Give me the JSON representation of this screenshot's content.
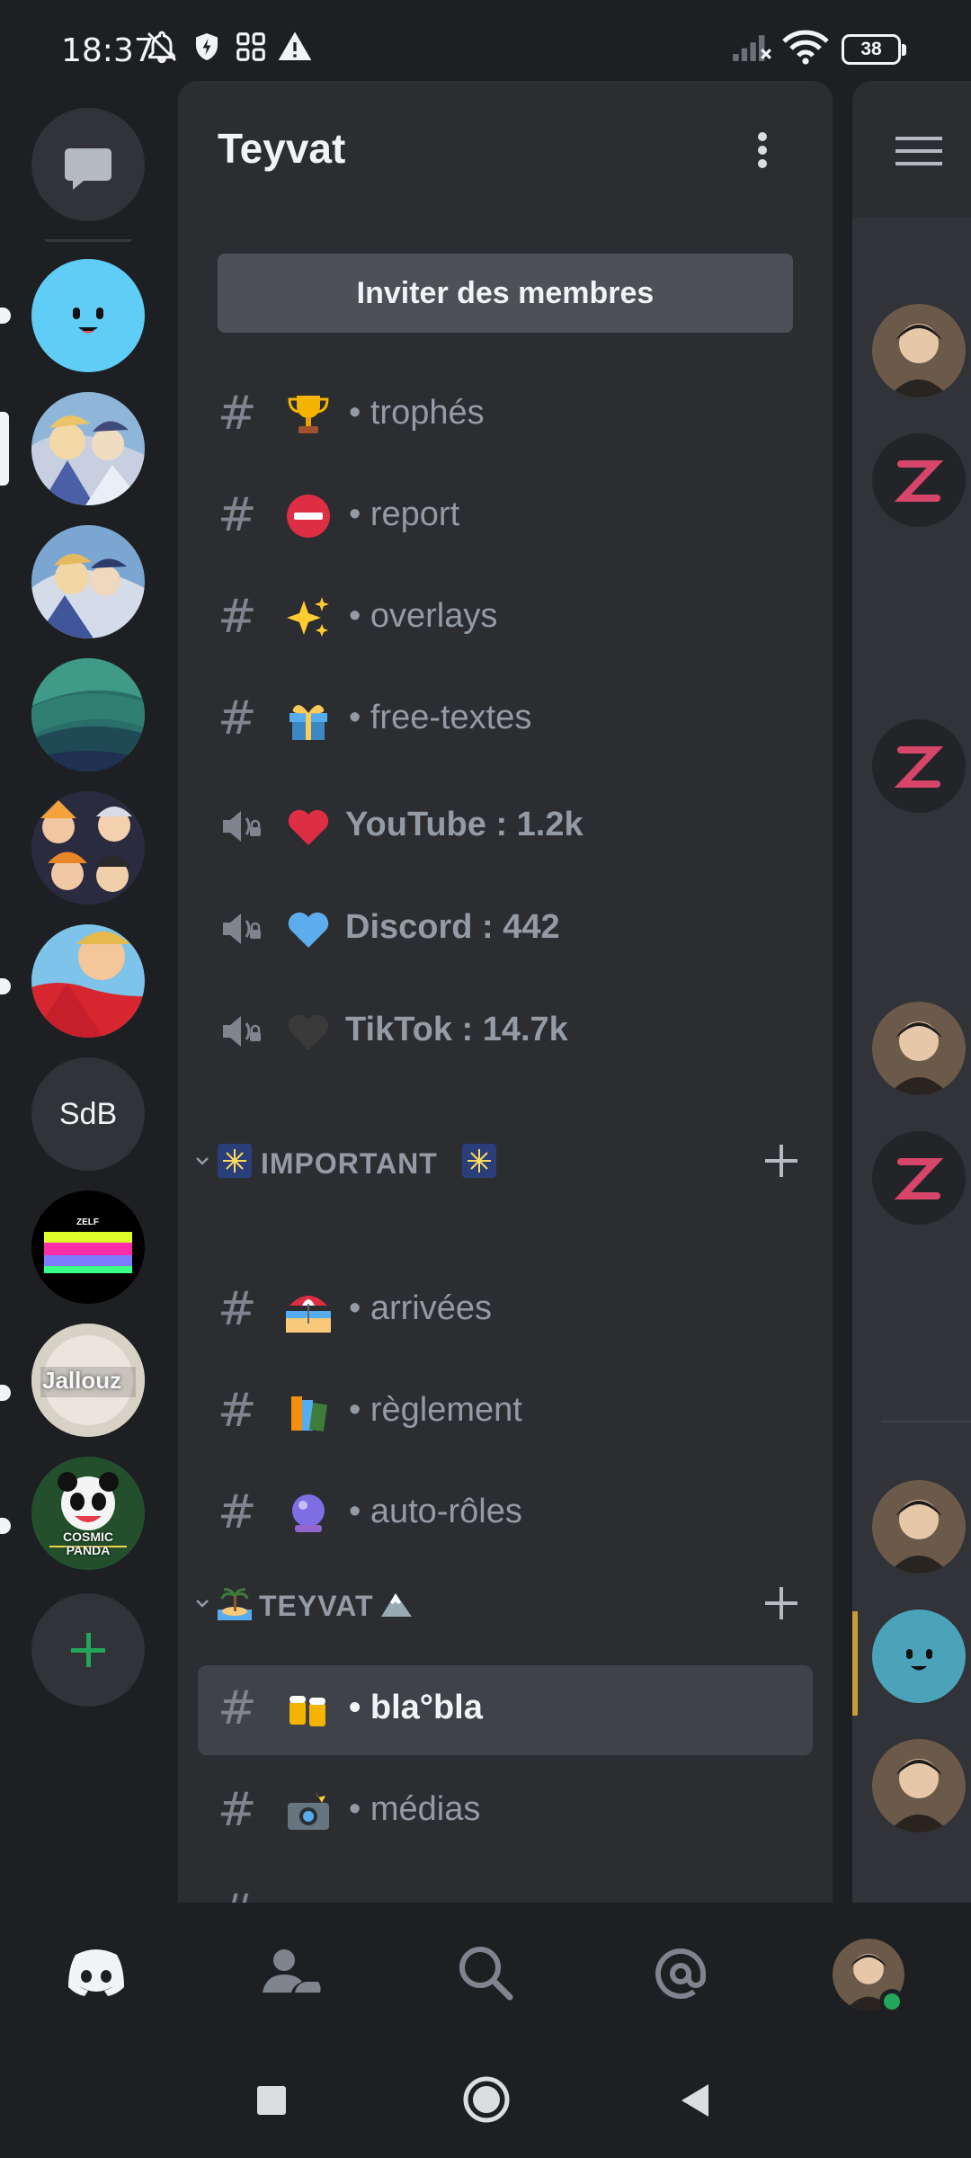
{
  "status_bar": {
    "time": "18:37",
    "battery": "38",
    "left_icons": [
      "bell-off-icon",
      "shield-icon",
      "apps-grid-icon",
      "warning-icon"
    ],
    "right_icons": [
      "signal-icon",
      "wifi-icon",
      "battery-icon"
    ]
  },
  "server": {
    "name": "Teyvat",
    "invite_label": "Inviter des membres"
  },
  "rail": {
    "sdb_label": "SdB",
    "zelf_label": "ZELF",
    "jallouz_label": "Jallouz",
    "cosmic_label": "COSMIC PANDA"
  },
  "channels_top": [
    {
      "type": "text",
      "emoji": "trophy",
      "name": "• trophés"
    },
    {
      "type": "text",
      "emoji": "no-entry",
      "name": "• report"
    },
    {
      "type": "text",
      "emoji": "sparkles",
      "name": "• overlays"
    },
    {
      "type": "text",
      "emoji": "gift",
      "name": "• free-textes"
    },
    {
      "type": "voice",
      "emoji": "red-heart",
      "name": "YouTube : 1.2k"
    },
    {
      "type": "voice",
      "emoji": "blue-heart",
      "name": "Discord : 442"
    },
    {
      "type": "voice",
      "emoji": "black-heart",
      "name": "TikTok : 14.7k"
    }
  ],
  "categories": [
    {
      "label": "IMPORTANT",
      "emoji_left": "fireworks",
      "emoji_right": "fireworks",
      "channels": [
        {
          "emoji": "beach-umbrella",
          "name": "• arrivées"
        },
        {
          "emoji": "books",
          "name": "• règlement"
        },
        {
          "emoji": "crystal-ball",
          "name": "• auto-rôles"
        }
      ]
    },
    {
      "label": "TEYVAT",
      "emoji_left": "desert-island",
      "emoji_right": "snow-mountain",
      "channels": [
        {
          "emoji": "beer-mugs",
          "name": "• bla°bla",
          "selected": true
        },
        {
          "emoji": "camera-flash",
          "name": "• médias"
        }
      ]
    }
  ],
  "colors": {
    "bg": "#1e1f22",
    "panel": "#2b2d31",
    "selected": "#404249",
    "button": "#4e5058",
    "muted": "#949ba4",
    "green": "#23a55a",
    "accent": "#c79a3a"
  },
  "bottom_nav": [
    "discord-home-icon",
    "friends-icon",
    "search-icon",
    "mentions-icon",
    "profile-avatar"
  ],
  "system_nav": [
    "recents-icon",
    "home-icon",
    "back-icon"
  ]
}
